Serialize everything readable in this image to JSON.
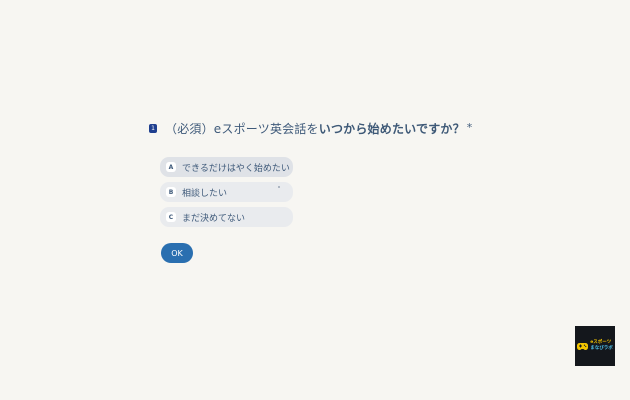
{
  "question": {
    "number": "1",
    "prefix": "（必須）eスポーツ英会話を",
    "emphasis": "いつから始めたいですか？",
    "required_mark": "*"
  },
  "options": [
    {
      "key": "A",
      "label": "できるだけはやく始めたい"
    },
    {
      "key": "B",
      "label": "相談したい"
    },
    {
      "key": "C",
      "label": "まだ決めてない"
    }
  ],
  "ok_button": {
    "label": "OK"
  },
  "logo": {
    "line1": "eスポーツ",
    "line2": "まなびラボ",
    "icon": "gamepad-icon",
    "colors": {
      "background": "#14171c",
      "line1": "#f2c400",
      "line2": "#4fc1e9"
    }
  },
  "colors": {
    "background": "#f7f6f2",
    "text": "#3f5a7a",
    "option_bg": "#e9ebee",
    "accent": "#2a6fb0",
    "question_badge": "#1f3f8f"
  }
}
